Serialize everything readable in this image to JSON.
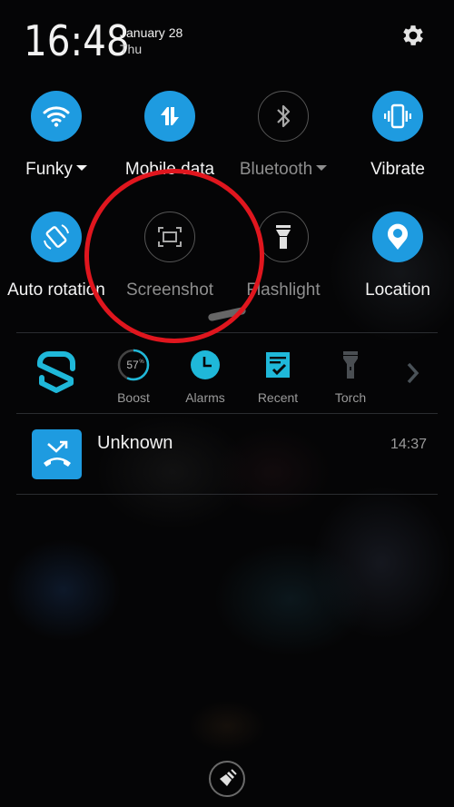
{
  "header": {
    "time": "16:48",
    "date": "January 28",
    "day": "Thu",
    "settings_icon": "gear-icon"
  },
  "quick_settings": {
    "row1": [
      {
        "label": "Funky",
        "icon": "wifi-icon",
        "active": true,
        "has_dropdown": true
      },
      {
        "label": "Mobile data",
        "icon": "data-transfer-icon",
        "active": true,
        "has_dropdown": false
      },
      {
        "label": "Bluetooth",
        "icon": "bluetooth-icon",
        "active": false,
        "has_dropdown": true
      },
      {
        "label": "Vibrate",
        "icon": "vibrate-icon",
        "active": true,
        "has_dropdown": false
      }
    ],
    "row2": [
      {
        "label": "Auto rotation",
        "icon": "auto-rotate-icon",
        "active": true
      },
      {
        "label": "Screenshot",
        "icon": "screenshot-icon",
        "active": false
      },
      {
        "label": "Flashlight",
        "icon": "flashlight-icon",
        "active": false
      },
      {
        "label": "Location",
        "icon": "location-pin-icon",
        "active": true
      }
    ]
  },
  "shortcuts": {
    "app_logo": "shield-s-logo",
    "items": [
      {
        "label": "Boost",
        "icon": "boost-gauge-icon",
        "value": "57",
        "unit": "%",
        "fraction": 0.57
      },
      {
        "label": "Alarms",
        "icon": "clock-icon"
      },
      {
        "label": "Recent",
        "icon": "checklist-icon"
      },
      {
        "label": "Torch",
        "icon": "torch-icon"
      }
    ],
    "more_icon": "chevron-right-icon"
  },
  "notifications": [
    {
      "title": "Unknown",
      "time": "14:37",
      "icon": "missed-call-icon"
    }
  ],
  "clear_button": {
    "icon": "broom-icon"
  },
  "annotation": {
    "type": "red-circle",
    "target": "Screenshot"
  },
  "colors": {
    "accent": "#1e9be0",
    "shortcut_accent": "#1fb8d9",
    "annotation": "#e0161e",
    "inactive_text": "#8e8e8e"
  }
}
